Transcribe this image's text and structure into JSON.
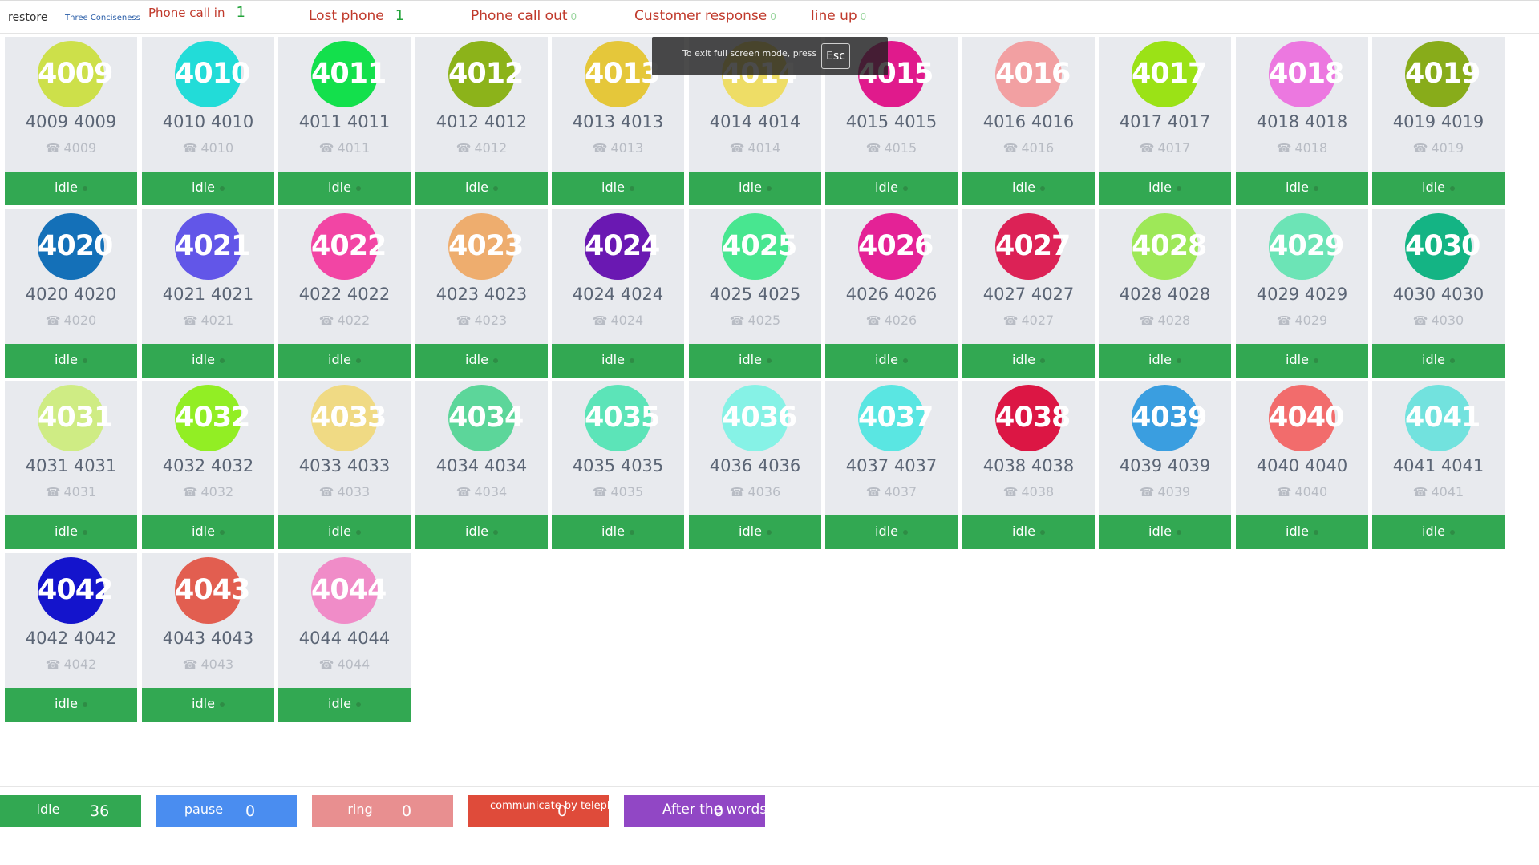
{
  "topbar": {
    "restore": "restore",
    "three": "Three Conciseness",
    "phone_call_in": {
      "label": "Phone call in",
      "count": "1"
    },
    "lost_phone": {
      "label": "Lost phone",
      "count": "1"
    },
    "phone_call_out": {
      "label": "Phone call out",
      "count": "0"
    },
    "customer_response": {
      "label": "Customer response",
      "count": "0"
    },
    "line_up": {
      "label": "line up",
      "count": "0"
    }
  },
  "fullscreen": {
    "message": "To exit full screen mode, press",
    "key": "Esc"
  },
  "agents": [
    {
      "id": "4009",
      "name": "4009 4009",
      "ext": "4009",
      "color": "#cde04a",
      "status": "idle"
    },
    {
      "id": "4010",
      "name": "4010 4010",
      "ext": "4010",
      "color": "#22dcd8",
      "status": "idle"
    },
    {
      "id": "4011",
      "name": "4011 4011",
      "ext": "4011",
      "color": "#13e04c",
      "status": "idle"
    },
    {
      "id": "4012",
      "name": "4012 4012",
      "ext": "4012",
      "color": "#8cb31a",
      "status": "idle"
    },
    {
      "id": "4013",
      "name": "4013 4013",
      "ext": "4013",
      "color": "#e5c73a",
      "status": "idle"
    },
    {
      "id": "4014",
      "name": "4014 4014",
      "ext": "4014",
      "color": "#eedd66",
      "status": "idle"
    },
    {
      "id": "4015",
      "name": "4015 4015",
      "ext": "4015",
      "color": "#e01a8c",
      "status": "idle"
    },
    {
      "id": "4016",
      "name": "4016 4016",
      "ext": "4016",
      "color": "#f2a0a2",
      "status": "idle"
    },
    {
      "id": "4017",
      "name": "4017 4017",
      "ext": "4017",
      "color": "#9be216",
      "status": "idle"
    },
    {
      "id": "4018",
      "name": "4018 4018",
      "ext": "4018",
      "color": "#ec78e0",
      "status": "idle"
    },
    {
      "id": "4019",
      "name": "4019 4019",
      "ext": "4019",
      "color": "#88ac1a",
      "status": "idle"
    },
    {
      "id": "4020",
      "name": "4020 4020",
      "ext": "4020",
      "color": "#1470b8",
      "status": "idle"
    },
    {
      "id": "4021",
      "name": "4021 4021",
      "ext": "4021",
      "color": "#6256e8",
      "status": "idle"
    },
    {
      "id": "4022",
      "name": "4022 4022",
      "ext": "4022",
      "color": "#f245a4",
      "status": "idle"
    },
    {
      "id": "4023",
      "name": "4023 4023",
      "ext": "4023",
      "color": "#eead6e",
      "status": "idle"
    },
    {
      "id": "4024",
      "name": "4024 4024",
      "ext": "4024",
      "color": "#6a18b2",
      "status": "idle"
    },
    {
      "id": "4025",
      "name": "4025 4025",
      "ext": "4025",
      "color": "#48e690",
      "status": "idle"
    },
    {
      "id": "4026",
      "name": "4026 4026",
      "ext": "4026",
      "color": "#e42296",
      "status": "idle"
    },
    {
      "id": "4027",
      "name": "4027 4027",
      "ext": "4027",
      "color": "#dc2256",
      "status": "idle"
    },
    {
      "id": "4028",
      "name": "4028 4028",
      "ext": "4028",
      "color": "#9ee858",
      "status": "idle"
    },
    {
      "id": "4029",
      "name": "4029 4029",
      "ext": "4029",
      "color": "#6ce4b6",
      "status": "idle"
    },
    {
      "id": "4030",
      "name": "4030 4030",
      "ext": "4030",
      "color": "#14b484",
      "status": "idle"
    },
    {
      "id": "4031",
      "name": "4031 4031",
      "ext": "4031",
      "color": "#cfec84",
      "status": "idle"
    },
    {
      "id": "4032",
      "name": "4032 4032",
      "ext": "4032",
      "color": "#92ee24",
      "status": "idle"
    },
    {
      "id": "4033",
      "name": "4033 4033",
      "ext": "4033",
      "color": "#f0da84",
      "status": "idle"
    },
    {
      "id": "4034",
      "name": "4034 4034",
      "ext": "4034",
      "color": "#5cd69a",
      "status": "idle"
    },
    {
      "id": "4035",
      "name": "4035 4035",
      "ext": "4035",
      "color": "#5ce4b8",
      "status": "idle"
    },
    {
      "id": "4036",
      "name": "4036 4036",
      "ext": "4036",
      "color": "#86f2e6",
      "status": "idle"
    },
    {
      "id": "4037",
      "name": "4037 4037",
      "ext": "4037",
      "color": "#5ae6e2",
      "status": "idle"
    },
    {
      "id": "4038",
      "name": "4038 4038",
      "ext": "4038",
      "color": "#dc1644",
      "status": "idle"
    },
    {
      "id": "4039",
      "name": "4039 4039",
      "ext": "4039",
      "color": "#3a9ee0",
      "status": "idle"
    },
    {
      "id": "4040",
      "name": "4040 4040",
      "ext": "4040",
      "color": "#f26c6c",
      "status": "idle"
    },
    {
      "id": "4041",
      "name": "4041 4041",
      "ext": "4041",
      "color": "#72e2de",
      "status": "idle"
    },
    {
      "id": "4042",
      "name": "4042 4042",
      "ext": "4042",
      "color": "#1414cc",
      "status": "idle"
    },
    {
      "id": "4043",
      "name": "4043 4043",
      "ext": "4043",
      "color": "#e25e50",
      "status": "idle"
    },
    {
      "id": "4044",
      "name": "4044 4044",
      "ext": "4044",
      "color": "#f08cc8",
      "status": "idle"
    }
  ],
  "summary": {
    "idle": {
      "label": "idle",
      "count": "36"
    },
    "pause": {
      "label": "pause",
      "count": "0"
    },
    "ring": {
      "label": "ring",
      "count": "0"
    },
    "communicate": {
      "label": "communicate by telephone",
      "count": "0"
    },
    "after": {
      "label": "After the words",
      "count": "0"
    }
  },
  "colors": {
    "idle_green": "#32a852",
    "pause_blue": "#4a8df0",
    "ring_pink": "#e88f90",
    "comm_red": "#df4b3a",
    "after_purple": "#9147c5",
    "top_red": "#c0392b"
  }
}
